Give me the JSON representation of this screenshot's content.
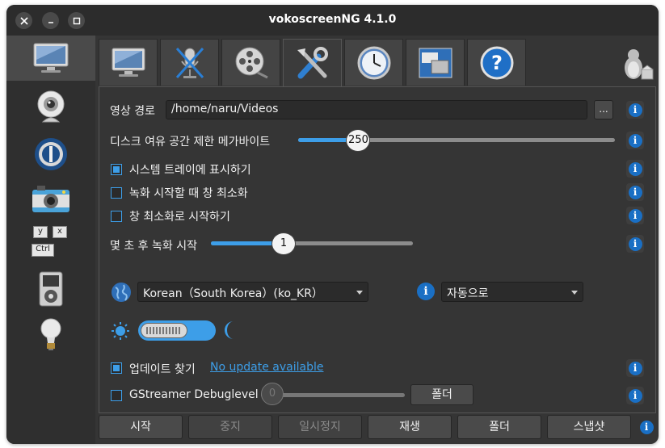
{
  "window": {
    "title": "vokoscreenNG 4.1.0"
  },
  "titlebar_icons": {
    "close": "close-icon",
    "minimize": "minimize-icon",
    "maximize": "maximize-icon"
  },
  "sidebar": {
    "items": [
      {
        "name": "sidebar-item-screen",
        "icon": "monitor-icon",
        "active": true
      },
      {
        "name": "sidebar-item-webcam",
        "icon": "webcam-icon"
      },
      {
        "name": "sidebar-item-player",
        "icon": "player-icon"
      },
      {
        "name": "sidebar-item-snapshot",
        "icon": "camera-icon"
      },
      {
        "name": "sidebar-item-shortcuts",
        "icon": "keyboard-icon"
      },
      {
        "name": "sidebar-item-media",
        "icon": "media-player-icon"
      },
      {
        "name": "sidebar-item-tips",
        "icon": "lightbulb-icon"
      }
    ],
    "keys": {
      "k1": "y",
      "k2": "x",
      "k3": "Ctrl"
    }
  },
  "tabs": [
    {
      "name": "tab-screen",
      "icon": "monitor-icon"
    },
    {
      "name": "tab-audio",
      "icon": "microphone-muted-icon"
    },
    {
      "name": "tab-video",
      "icon": "film-reel-icon"
    },
    {
      "name": "tab-settings",
      "icon": "tools-icon",
      "active": true
    },
    {
      "name": "tab-timer",
      "icon": "clock-icon"
    },
    {
      "name": "tab-windows",
      "icon": "windows-icon"
    },
    {
      "name": "tab-help",
      "icon": "help-icon",
      "label": "?"
    }
  ],
  "settings": {
    "video_path_label": "영상 경로",
    "video_path_value": "/home/naru/Videos",
    "browse_label": "...",
    "disk_space_label": "디스크 여유 공간 제한  메가바이트",
    "disk_space_value": "250",
    "disk_space_fraction": 0.19,
    "show_tray_label": "시스템 트레이에 표시하기",
    "show_tray_checked": true,
    "minimize_on_record_label": "녹화 시작할 때 창 최소화",
    "minimize_on_record_checked": false,
    "start_minimized_label": "창 최소화로 시작하기",
    "start_minimized_checked": false,
    "countdown_label": "몇 초 후 녹화 시작",
    "countdown_value": "1",
    "countdown_fraction": 0.36,
    "language_value": "Korean（South Korea）(ko_KR）",
    "language_icon": "globe-icon",
    "style_value": "자동으로",
    "theme_light_icon": "sun-icon",
    "theme_dark_icon": "moon-icon",
    "theme_toggle_state": "light",
    "update_label": "업데이트 찾기",
    "update_checked": true,
    "update_link": "No update available",
    "gst_label": "GStreamer Debuglevel",
    "gst_checked": false,
    "gst_value": "0",
    "folder_label": "폴더"
  },
  "bottom": {
    "start": "시작",
    "stop": "중지",
    "pause": "일시정지",
    "play": "재생",
    "folder": "폴더",
    "snapshot": "스냅샷"
  },
  "colors": {
    "accent": "#3d9ee8",
    "background": "#353535",
    "info_blue": "#1a6fc4"
  }
}
